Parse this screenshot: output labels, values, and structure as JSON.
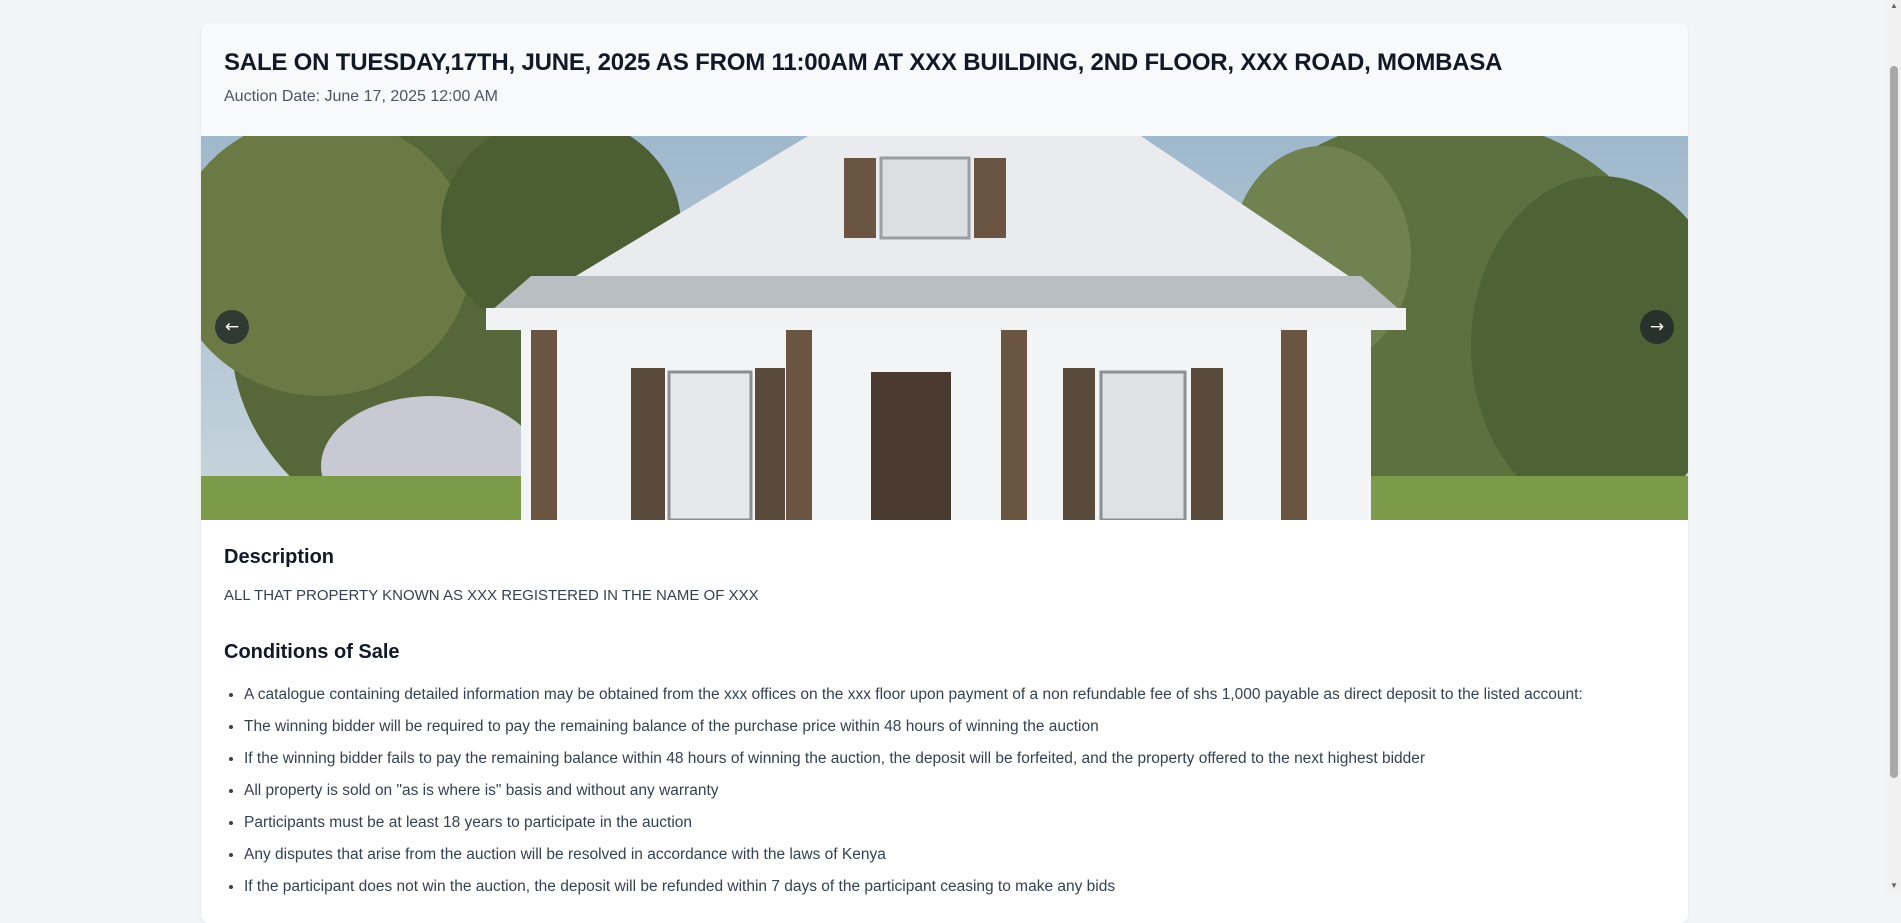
{
  "listing": {
    "title": "SALE ON TUESDAY,17TH, JUNE, 2025 AS FROM 11:00AM AT XXX BUILDING, 2ND FLOOR, XXX ROAD, MOMBASA",
    "auction_date": "Auction Date: June 17, 2025 12:00 AM"
  },
  "carousel": {
    "prev_label": "←",
    "next_label": "→"
  },
  "description": {
    "heading": "Description",
    "text": "ALL THAT PROPERTY KNOWN AS XXX REGISTERED IN THE NAME OF XXX"
  },
  "conditions": {
    "heading": "Conditions of Sale",
    "items": [
      "A catalogue containing detailed information may be obtained from the xxx offices on the xxx floor upon payment of a non refundable fee of shs 1,000 payable as direct deposit to the listed account:",
      "The winning bidder will be required to pay the remaining balance of the purchase price within 48 hours of winning the auction",
      "If the winning bidder fails to pay the remaining balance within 48 hours of winning the auction, the deposit will be forfeited, and the property offered to the next highest bidder",
      "All property is sold on \"as is where is\" basis and without any warranty",
      "Participants must be at least 18 years to participate in the auction",
      "Any disputes that arise from the auction will be resolved in accordance with the laws of Kenya",
      "If the participant does not win the auction, the deposit will be refunded within 7 days of the participant ceasing to make any bids"
    ]
  }
}
